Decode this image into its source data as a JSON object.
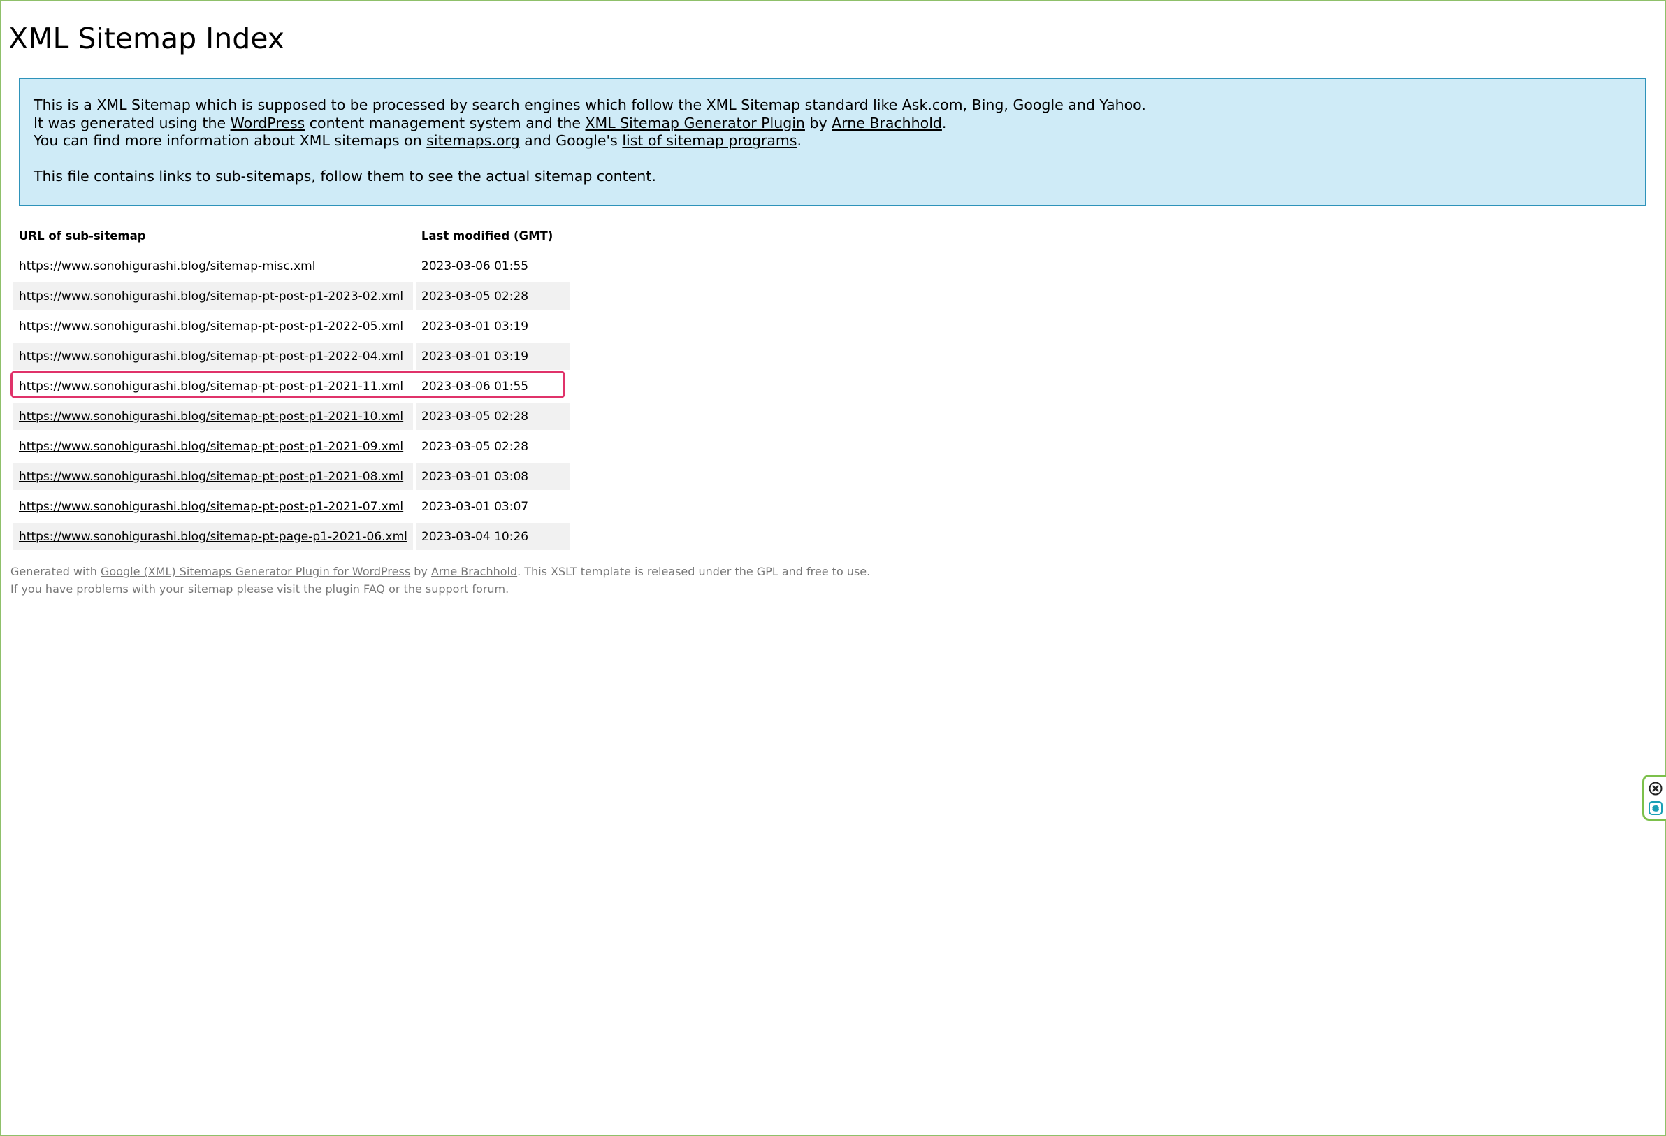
{
  "page": {
    "title": "XML Sitemap Index"
  },
  "intro": {
    "line1": "This is a XML Sitemap which is supposed to be processed by search engines which follow the XML Sitemap standard like Ask.com, Bing, Google and Yahoo.",
    "line2_pre": "It was generated using the ",
    "line2_link1": "WordPress",
    "line2_mid": " content management system and the ",
    "line2_link2": "XML Sitemap Generator Plugin",
    "line2_by": " by ",
    "line2_link3": "Arne Brachhold",
    "line2_end": ".",
    "line3_pre": "You can find more information about XML sitemaps on ",
    "line3_link1": "sitemaps.org",
    "line3_mid": " and Google's ",
    "line3_link2": "list of sitemap programs",
    "line3_end": ".",
    "line4": "This file contains links to sub-sitemaps, follow them to see the actual sitemap content."
  },
  "table": {
    "headers": {
      "url": "URL of sub-sitemap",
      "modified": "Last modified (GMT)"
    },
    "rows": [
      {
        "url": "https://www.sonohigurashi.blog/sitemap-misc.xml",
        "modified": "2023-03-06 01:55"
      },
      {
        "url": "https://www.sonohigurashi.blog/sitemap-pt-post-p1-2023-02.xml",
        "modified": "2023-03-05 02:28"
      },
      {
        "url": "https://www.sonohigurashi.blog/sitemap-pt-post-p1-2022-05.xml",
        "modified": "2023-03-01 03:19"
      },
      {
        "url": "https://www.sonohigurashi.blog/sitemap-pt-post-p1-2022-04.xml",
        "modified": "2023-03-01 03:19"
      },
      {
        "url": "https://www.sonohigurashi.blog/sitemap-pt-post-p1-2021-11.xml",
        "modified": "2023-03-06 01:55"
      },
      {
        "url": "https://www.sonohigurashi.blog/sitemap-pt-post-p1-2021-10.xml",
        "modified": "2023-03-05 02:28"
      },
      {
        "url": "https://www.sonohigurashi.blog/sitemap-pt-post-p1-2021-09.xml",
        "modified": "2023-03-05 02:28"
      },
      {
        "url": "https://www.sonohigurashi.blog/sitemap-pt-post-p1-2021-08.xml",
        "modified": "2023-03-01 03:08"
      },
      {
        "url": "https://www.sonohigurashi.blog/sitemap-pt-post-p1-2021-07.xml",
        "modified": "2023-03-01 03:07"
      },
      {
        "url": "https://www.sonohigurashi.blog/sitemap-pt-page-p1-2021-06.xml",
        "modified": "2023-03-04 10:26"
      }
    ]
  },
  "footer": {
    "l1_pre": "Generated with ",
    "l1_link1": "Google (XML) Sitemaps Generator Plugin for WordPress",
    "l1_by": " by ",
    "l1_link2": "Arne Brachhold",
    "l1_end": ". This XSLT template is released under the GPL and free to use.",
    "l2_pre": "If you have problems with your sitemap please visit the ",
    "l2_link1": "plugin FAQ",
    "l2_mid": " or the ",
    "l2_link2": "support forum",
    "l2_end": "."
  },
  "widget": {
    "icons": [
      "close-circle-icon",
      "extension-e-icon"
    ],
    "accent": "#7cc04b"
  },
  "colors": {
    "intro_bg": "#cfebf7",
    "intro_border": "#2e93ba",
    "row_alt_bg": "#f1f1f1",
    "highlight": "#e0336a",
    "footer_text": "#777777"
  }
}
